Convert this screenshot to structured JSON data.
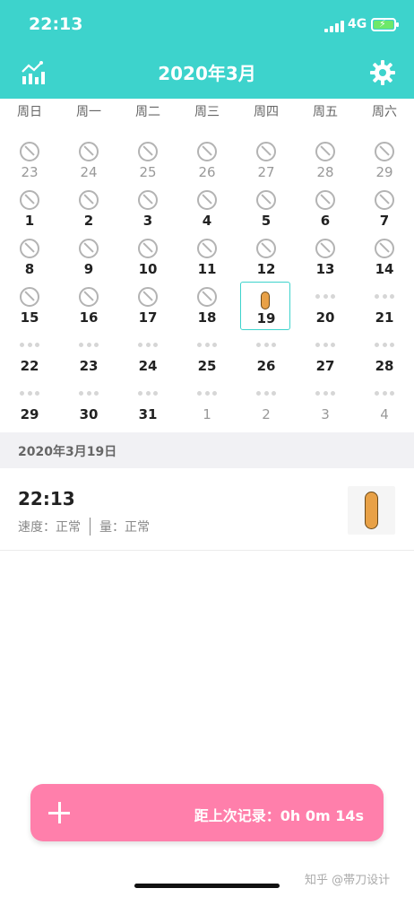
{
  "status_bar": {
    "time": "22:13",
    "network": "4G"
  },
  "header": {
    "title": "2020年3月",
    "chart_icon": "chart-icon",
    "settings_icon": "gear-icon"
  },
  "weekdays": [
    "周日",
    "周一",
    "周二",
    "周三",
    "周四",
    "周五",
    "周六"
  ],
  "calendar": {
    "weeks": [
      [
        {
          "d": "23",
          "m": "no",
          "o": true
        },
        {
          "d": "24",
          "m": "no",
          "o": true
        },
        {
          "d": "25",
          "m": "no",
          "o": true
        },
        {
          "d": "26",
          "m": "no",
          "o": true
        },
        {
          "d": "27",
          "m": "no",
          "o": true
        },
        {
          "d": "28",
          "m": "no",
          "o": true
        },
        {
          "d": "29",
          "m": "no",
          "o": true
        }
      ],
      [
        {
          "d": "1",
          "m": "no"
        },
        {
          "d": "2",
          "m": "no"
        },
        {
          "d": "3",
          "m": "no"
        },
        {
          "d": "4",
          "m": "no"
        },
        {
          "d": "5",
          "m": "no"
        },
        {
          "d": "6",
          "m": "no"
        },
        {
          "d": "7",
          "m": "no"
        }
      ],
      [
        {
          "d": "8",
          "m": "no"
        },
        {
          "d": "9",
          "m": "no"
        },
        {
          "d": "10",
          "m": "no"
        },
        {
          "d": "11",
          "m": "no"
        },
        {
          "d": "12",
          "m": "no"
        },
        {
          "d": "13",
          "m": "no"
        },
        {
          "d": "14",
          "m": "no"
        }
      ],
      [
        {
          "d": "15",
          "m": "no"
        },
        {
          "d": "16",
          "m": "no"
        },
        {
          "d": "17",
          "m": "no"
        },
        {
          "d": "18",
          "m": "no"
        },
        {
          "d": "19",
          "m": "pill",
          "sel": true
        },
        {
          "d": "20",
          "m": "dots"
        },
        {
          "d": "21",
          "m": "dots"
        }
      ],
      [
        {
          "d": "22",
          "m": "dots"
        },
        {
          "d": "23",
          "m": "dots"
        },
        {
          "d": "24",
          "m": "dots"
        },
        {
          "d": "25",
          "m": "dots"
        },
        {
          "d": "26",
          "m": "dots"
        },
        {
          "d": "27",
          "m": "dots"
        },
        {
          "d": "28",
          "m": "dots"
        }
      ],
      [
        {
          "d": "29",
          "m": "dots"
        },
        {
          "d": "30",
          "m": "dots"
        },
        {
          "d": "31",
          "m": "dots"
        },
        {
          "d": "1",
          "m": "dots",
          "o": true
        },
        {
          "d": "2",
          "m": "dots",
          "o": true
        },
        {
          "d": "3",
          "m": "dots",
          "o": true
        },
        {
          "d": "4",
          "m": "dots",
          "o": true
        }
      ]
    ]
  },
  "selected_date_label": "2020年3月19日",
  "record": {
    "time": "22:13",
    "speed": "速度：正常",
    "amount": "量：正常"
  },
  "add_bar": {
    "last_record": "距上次记录：0h 0m 14s",
    "icon": "plus-icon"
  },
  "watermark": "知乎 @帯刀设计",
  "colors": {
    "accent": "#3dd3cc",
    "pink": "#ff7fab",
    "pill": "#e8a147"
  }
}
